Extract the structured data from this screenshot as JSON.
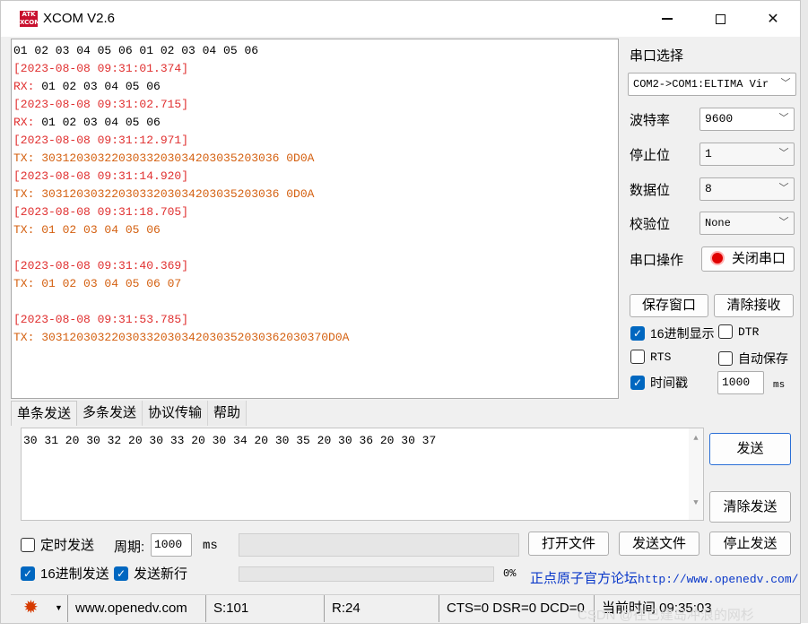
{
  "window": {
    "title": "XCOM V2.6",
    "logo_text": "ATK\nXCOM"
  },
  "receive": {
    "lines": [
      {
        "text": "01 02 03 04 05 06 01 02 03 04 05 06",
        "color": "black"
      },
      {
        "text": "[2023-08-08 09:31:01.374]",
        "color": "red"
      },
      {
        "text": "RX: 01 02 03 04 05 06",
        "color": "black",
        "prefix": "RX:"
      },
      {
        "text": "[2023-08-08 09:31:02.715]",
        "color": "red"
      },
      {
        "text": "RX: 01 02 03 04 05 06",
        "color": "black",
        "prefix": "RX:"
      },
      {
        "text": "[2023-08-08 09:31:12.971]",
        "color": "red"
      },
      {
        "text": "TX: 3031203032203033203034203035203036 0D0A",
        "color": "orange"
      },
      {
        "text": "[2023-08-08 09:31:14.920]",
        "color": "red"
      },
      {
        "text": "TX: 3031203032203033203034203035203036 0D0A",
        "color": "orange"
      },
      {
        "text": "[2023-08-08 09:31:18.705]",
        "color": "red"
      },
      {
        "text": "TX: 01 02 03 04 05 06",
        "color": "orange"
      },
      {
        "text": "",
        "color": "black"
      },
      {
        "text": "[2023-08-08 09:31:40.369]",
        "color": "red"
      },
      {
        "text": "TX: 01 02 03 04 05 06 07",
        "color": "orange"
      },
      {
        "text": "",
        "color": "black"
      },
      {
        "text": "[2023-08-08 09:31:53.785]",
        "color": "red"
      },
      {
        "text": "TX: 30312030322030332030342030352030362030370D0A",
        "color": "orange"
      }
    ]
  },
  "settings": {
    "port_label": "串口选择",
    "port_value": "COM2->COM1:ELTIMA Vir",
    "baud_label": "波特率",
    "baud_value": "9600",
    "stop_label": "停止位",
    "stop_value": "1",
    "data_label": "数据位",
    "data_value": "8",
    "parity_label": "校验位",
    "parity_value": "None",
    "op_label": "串口操作",
    "op_button": "关闭串口",
    "save_button": "保存窗口",
    "clear_recv_button": "清除接收",
    "hex_display": "16进制显示",
    "dtr": "DTR",
    "rts": "RTS",
    "auto_save": "自动保存",
    "timestamp": "时间戳",
    "timestamp_value": "1000",
    "timestamp_unit": "ms"
  },
  "tabs": [
    "单条发送",
    "多条发送",
    "协议传输",
    "帮助"
  ],
  "send": {
    "content": "30 31 20 30 32 20 30 33 20 30 34 20 30 35 20 30 36 20 30 37",
    "send_button": "发送",
    "clear_send_button": "清除发送",
    "timed_send": "定时发送",
    "period_label": "周期:",
    "period_value": "1000",
    "period_unit": "ms",
    "open_file": "打开文件",
    "send_file": "发送文件",
    "stop_send": "停止发送",
    "hex_send": "16进制发送",
    "newline": "发送新行",
    "progress_percent": "0%",
    "progress_value": 0,
    "forum_text": "正点原子官方论坛",
    "forum_link": "http://www.openedv.com/"
  },
  "status": {
    "url": "www.openedv.com",
    "sent": "S:101",
    "received": "R:24",
    "lines": "CTS=0 DSR=0 DCD=0",
    "time": "当前时间 09:35:03"
  },
  "watermark": "CSDN @往已建岛冲浪的网杉",
  "colors": {
    "red": "#e03030",
    "orange": "#d46010",
    "accent": "#0067c0",
    "link": "#0a38c9"
  }
}
